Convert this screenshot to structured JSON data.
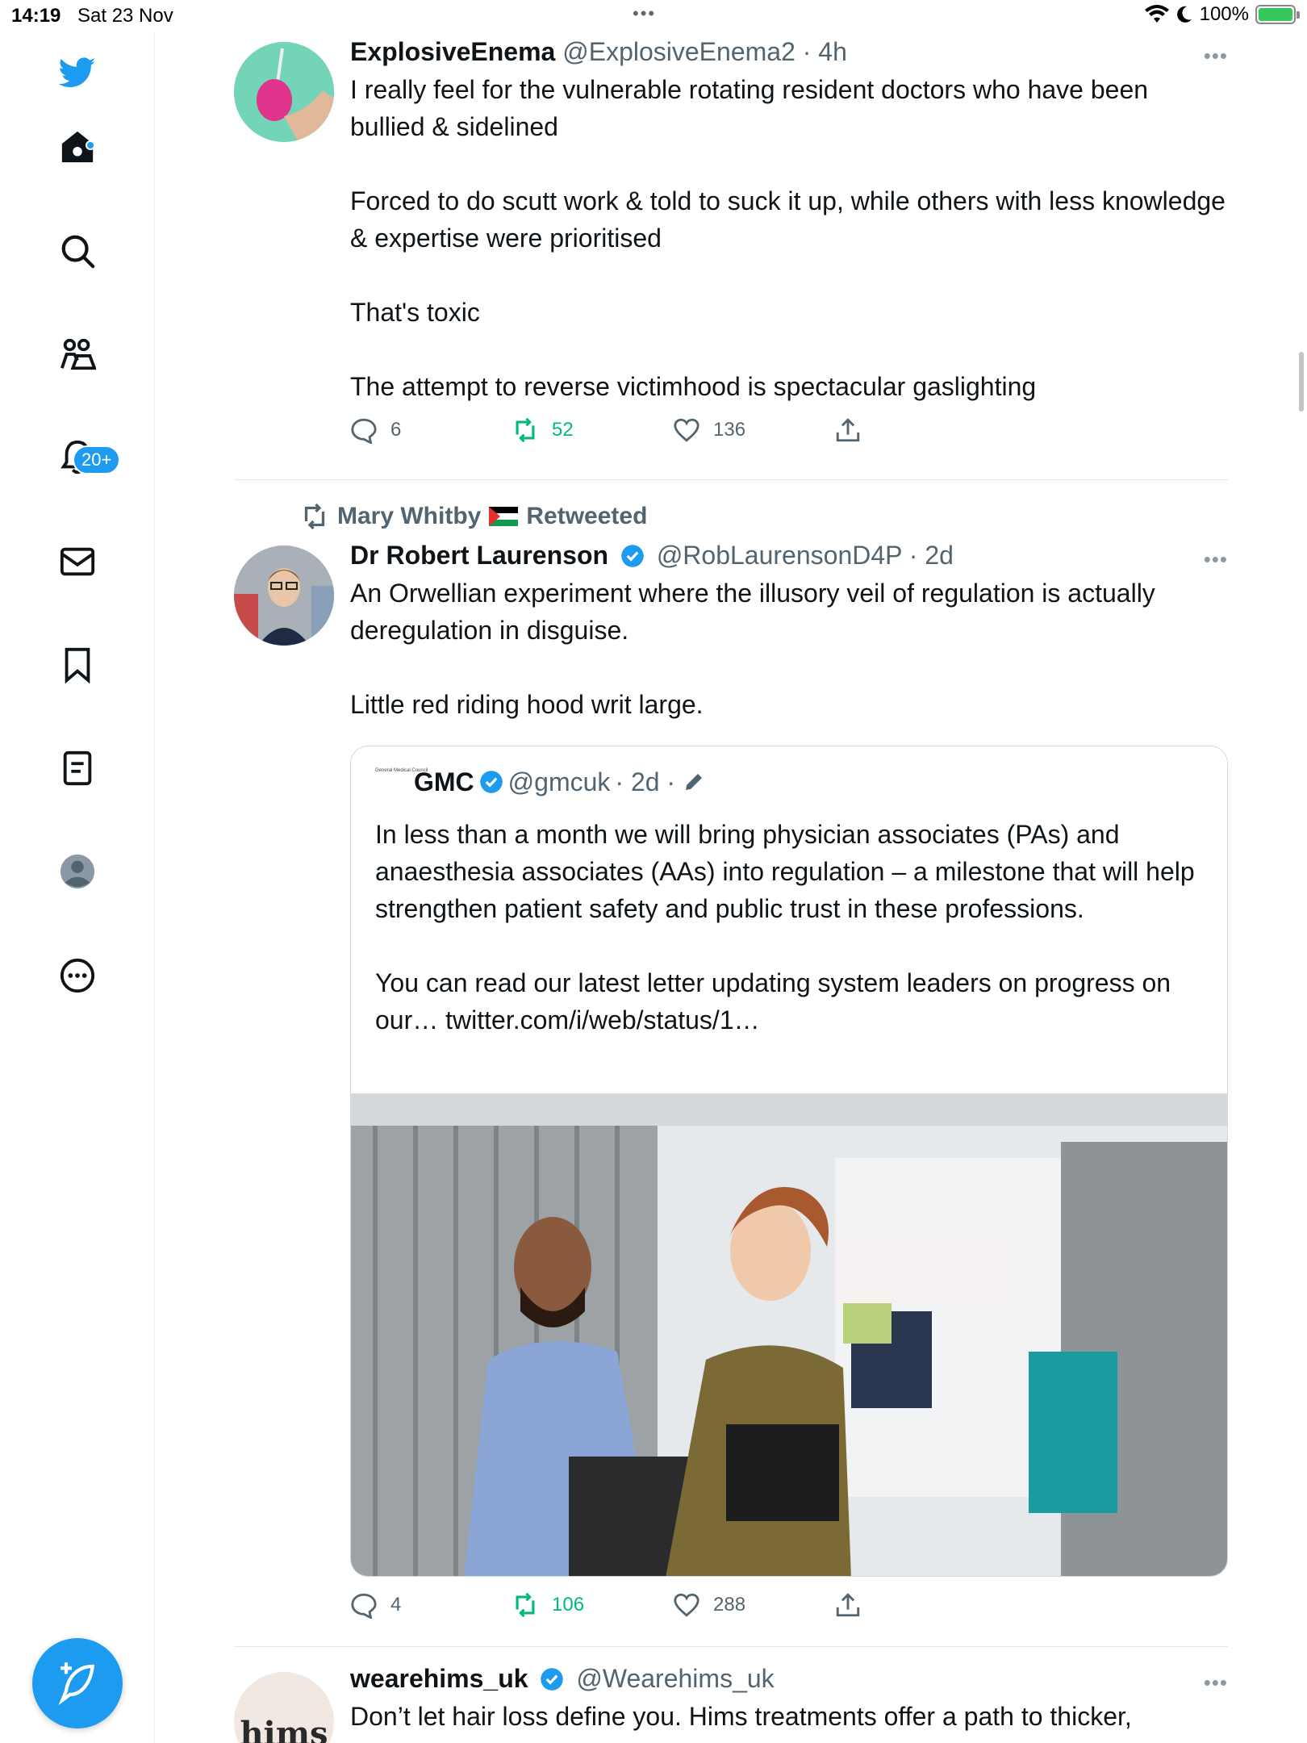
{
  "status_bar": {
    "time": "14:19",
    "date": "Sat 23 Nov",
    "dots": "•••",
    "battery": "100%"
  },
  "sidebar": {
    "notifications_badge": "20+",
    "icons": [
      "twitter-logo-icon",
      "home-icon",
      "search-icon",
      "communities-icon",
      "notifications-icon",
      "messages-icon",
      "bookmarks-icon",
      "lists-icon",
      "profile-icon",
      "more-icon"
    ]
  },
  "colors": {
    "brand": "#1d9bf0",
    "retweet": "#00ba7c",
    "secondary_text": "#536471"
  },
  "tweets": [
    {
      "name": "ExplosiveEnema",
      "handle": "@ExplosiveEnema2",
      "time": "· 4h",
      "text": "I really feel for the vulnerable rotating resident doctors who have been bullied & sidelined\n\nForced to do scutt work & told to suck it up, while others with less knowledge & expertise were prioritised\n\nThat's toxic\n\nThe attempt to reverse victimhood is spectacular gaslighting",
      "replies": "6",
      "retweets": "52",
      "likes": "136"
    },
    {
      "retweeted_by": "Mary Whitby",
      "retweeted_label": "Retweeted",
      "name": "Dr Robert Laurenson",
      "handle": "@RobLaurensonD4P",
      "time": "· 2d",
      "text": "An Orwellian experiment where the illusory veil of regulation is actually deregulation in disguise.\n\nLittle red riding hood writ large.",
      "quote": {
        "logo_text": "General Medical Council",
        "name": "GMC",
        "handle": "@gmcuk",
        "time": "· 2d ·",
        "text": "In less than a month we will bring physician associates (PAs) and anaesthesia associates (AAs) into regulation – a milestone that will help strengthen patient safety and public trust in these professions.\n\nYou can read our latest letter updating system leaders on progress on our… twitter.com/i/web/status/1…"
      },
      "replies": "4",
      "retweets": "106",
      "likes": "288"
    },
    {
      "avatar_text": "hims",
      "name": "wearehims_uk",
      "handle": "@Wearehims_uk",
      "text": "Don’t let hair loss define you. Hims treatments offer a path to thicker,"
    }
  ]
}
